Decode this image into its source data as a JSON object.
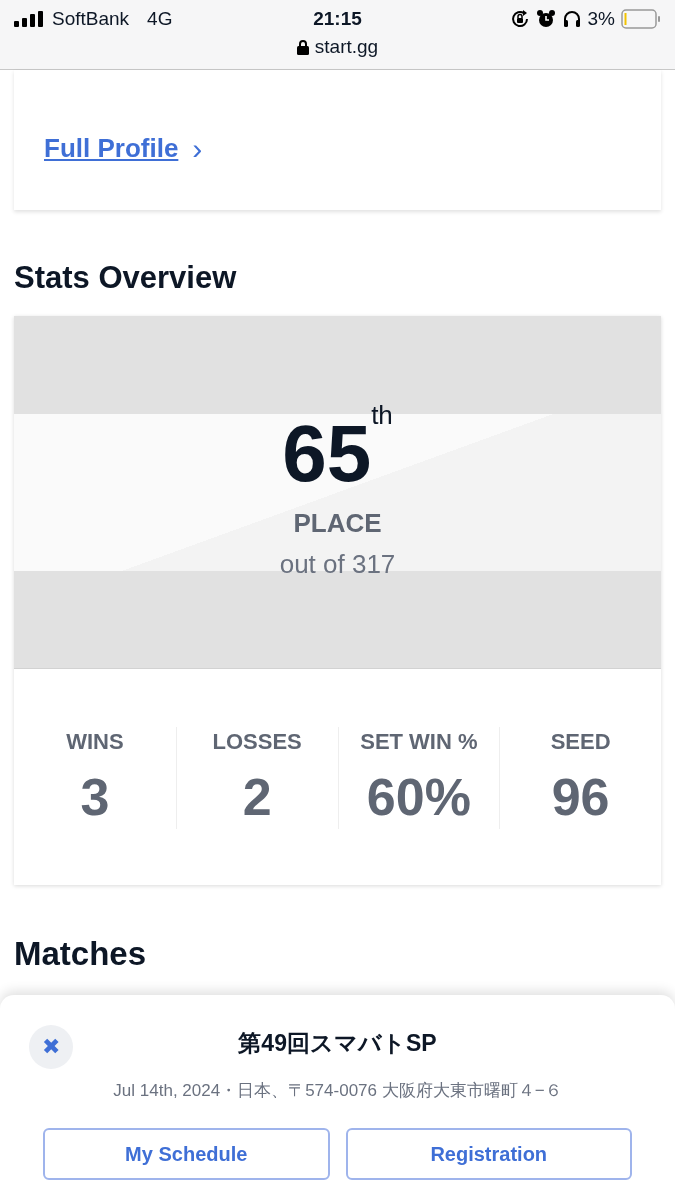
{
  "status_bar": {
    "carrier": "SoftBank",
    "network": "4G",
    "time": "21:15",
    "battery_percent": "3%"
  },
  "address_bar": {
    "url": "start.gg"
  },
  "profile_card": {
    "link": "Full Profile",
    "chevron": "›"
  },
  "stats_overview": {
    "heading": "Stats Overview",
    "place": "65",
    "place_suffix": "th",
    "place_label": "PLACE",
    "out_of": "out of 317",
    "stats": [
      {
        "label": "WINS",
        "value": "3"
      },
      {
        "label": "LOSSES",
        "value": "2"
      },
      {
        "label": "SET WIN %",
        "value": "60%"
      },
      {
        "label": "SEED",
        "value": "96"
      }
    ]
  },
  "matches": {
    "heading": "Matches"
  },
  "event_sheet": {
    "close": "✖",
    "title": "第49回スマバトSP",
    "subtitle": "Jul 14th, 2024・日本、〒574-0076 大阪府大東市曙町４−６",
    "buttons": [
      "My Schedule",
      "Registration"
    ]
  }
}
